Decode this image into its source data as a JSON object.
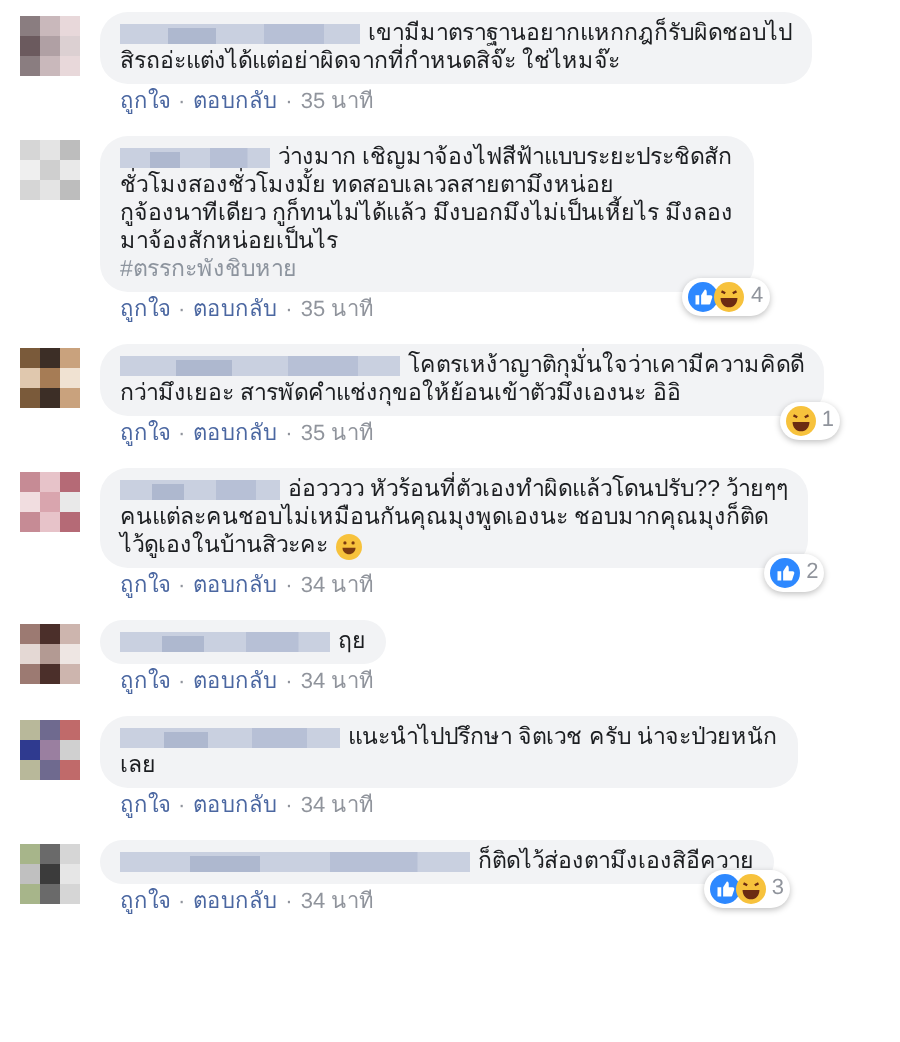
{
  "separator": "·",
  "comments": [
    {
      "lines": [
        "เขามีมาตราฐานอยากแหกกฎก็รับผิดชอบไป",
        "สิรถอ่ะแต่งได้แต่อย่าผิดจากที่กำหนดสิจ๊ะ ใช่ไหมจ๊ะ"
      ],
      "like": "ถูกใจ",
      "reply": "ตอบกลับ",
      "time": "35 นาที"
    },
    {
      "lines": [
        "ว่างมาก เชิญมาจ้องไฟสีฟ้าแบบระยะประชิดสัก",
        "ชั่วโมงสองชั่วโมงมั้ย ทดสอบเลเวลสายตามึงหน่อย",
        "กูจ้องนาทีเดียว กูก็ทนไม่ได้แล้ว มึงบอกมึงไม่เป็นเหี้ยไร มึงลอง",
        "มาจ้องสักหน่อยเป็นไร"
      ],
      "hashtag": "#ตรรกะพังชิบหาย",
      "reactions": [
        {
          "kind": "like"
        },
        {
          "kind": "haha"
        }
      ],
      "count": "4",
      "like": "ถูกใจ",
      "reply": "ตอบกลับ",
      "time": "35 นาที"
    },
    {
      "lines": [
        "โคตรเหง้าญาติกุมั่นใจว่าเคามีความคิดดี",
        "กว่ามึงเยอะ สารพัดคำแช่งกุขอให้ย้อนเข้าตัวมึงเองนะ อิอิ"
      ],
      "reactions": [
        {
          "kind": "haha"
        }
      ],
      "count": "1",
      "like": "ถูกใจ",
      "reply": "ตอบกลับ",
      "time": "35 นาที"
    },
    {
      "lines": [
        "อ่อวววว หัวร้อนที่ตัวเองทำผิดแล้วโดนปรับ?? ว้ายๆๆ",
        "คนแต่ละคนชอบไม่เหมือนกันคุณมุงพูดเองนะ ชอบมากคุณมุงก็ติด",
        "ไว้ดูเองในบ้านสิวะคะ"
      ],
      "emoji": true,
      "reactions": [
        {
          "kind": "like"
        }
      ],
      "count": "2",
      "like": "ถูกใจ",
      "reply": "ตอบกลับ",
      "time": "34 นาที"
    },
    {
      "lines": [
        "ฤย"
      ],
      "like": "ถูกใจ",
      "reply": "ตอบกลับ",
      "time": "34 นาที"
    },
    {
      "lines": [
        "แนะนำไปปรึกษา จิตเวช ครับ น่าจะป่วยหนัก",
        "เลย"
      ],
      "like": "ถูกใจ",
      "reply": "ตอบกลับ",
      "time": "34 นาที"
    },
    {
      "lines": [
        "ก็ติดไว้ส่องตามึงเองสิอีควาย"
      ],
      "reactions": [
        {
          "kind": "like"
        },
        {
          "kind": "haha"
        }
      ],
      "count": "3",
      "like": "ถูกใจ",
      "reply": "ตอบกลับ",
      "time": "34 นาที"
    }
  ]
}
